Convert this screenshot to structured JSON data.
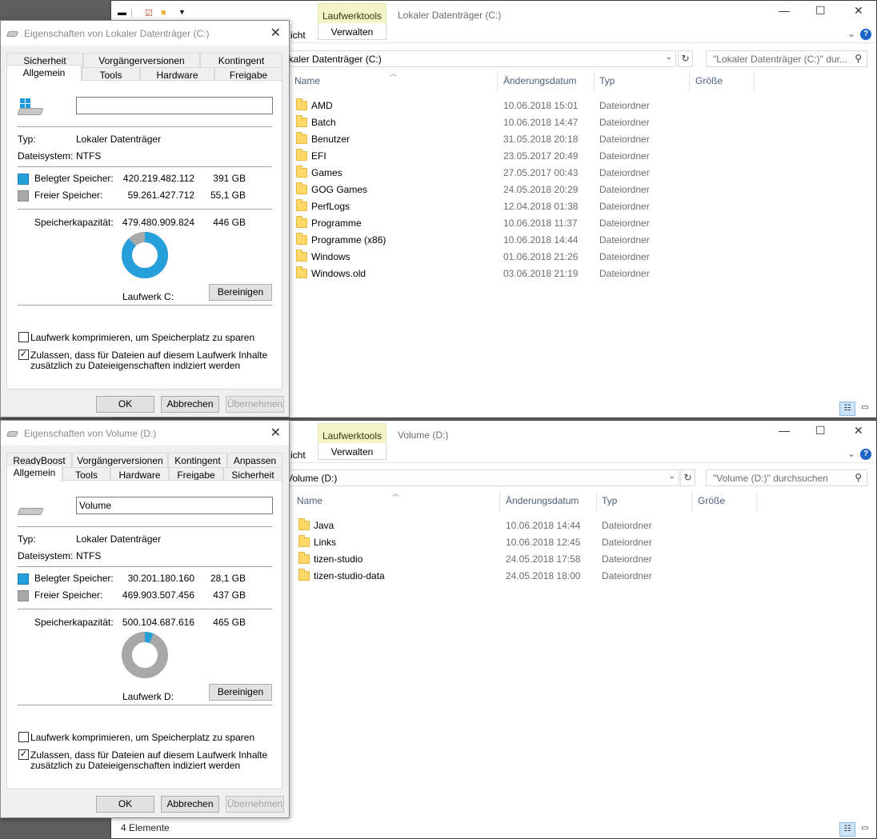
{
  "explorer_c": {
    "ribbon_ctx_tab": "Laufwerktools",
    "title": "Lokaler Datenträger (C:)",
    "ribbon_left_partial": "icht",
    "ribbon_manage": "Verwalten",
    "address_partial": "okaler Datenträger (C:)",
    "search_placeholder": "\"Lokaler Datenträger (C:)\" dur...",
    "col_name": "Name",
    "col_date": "Änderungsdatum",
    "col_type": "Typ",
    "col_size": "Größe",
    "rows": [
      {
        "name": "AMD",
        "date": "10.06.2018 15:01",
        "type": "Dateiordner"
      },
      {
        "name": "Batch",
        "date": "10.06.2018 14:47",
        "type": "Dateiordner"
      },
      {
        "name": "Benutzer",
        "date": "31.05.2018 20:18",
        "type": "Dateiordner"
      },
      {
        "name": "EFI",
        "date": "23.05.2017 20:49",
        "type": "Dateiordner"
      },
      {
        "name": "Games",
        "date": "27.05.2017 00:43",
        "type": "Dateiordner"
      },
      {
        "name": "GOG Games",
        "date": "24.05.2018 20:29",
        "type": "Dateiordner"
      },
      {
        "name": "PerfLogs",
        "date": "12.04.2018 01:38",
        "type": "Dateiordner"
      },
      {
        "name": "Programme",
        "date": "10.06.2018 11:37",
        "type": "Dateiordner"
      },
      {
        "name": "Programme (x86)",
        "date": "10.06.2018 14:44",
        "type": "Dateiordner"
      },
      {
        "name": "Windows",
        "date": "01.06.2018 21:26",
        "type": "Dateiordner"
      },
      {
        "name": "Windows.old",
        "date": "03.06.2018 21:19",
        "type": "Dateiordner"
      }
    ]
  },
  "explorer_d": {
    "ribbon_ctx_tab": "Laufwerktools",
    "title": "Volume (D:)",
    "ribbon_left_partial": "icht",
    "ribbon_manage": "Verwalten",
    "address_partial": "Volume (D:)",
    "search_placeholder": "\"Volume (D:)\" durchsuchen",
    "col_name": "Name",
    "col_date": "Änderungsdatum",
    "col_type": "Typ",
    "col_size": "Größe",
    "rows": [
      {
        "name": "Java",
        "date": "10.06.2018 14:44",
        "type": "Dateiordner"
      },
      {
        "name": "Links",
        "date": "10.06.2018 12:45",
        "type": "Dateiordner"
      },
      {
        "name": "tizen-studio",
        "date": "24.05.2018 17:58",
        "type": "Dateiordner"
      },
      {
        "name": "tizen-studio-data",
        "date": "24.05.2018 18:00",
        "type": "Dateiordner"
      }
    ],
    "status": "4 Elemente"
  },
  "dialog_c": {
    "title": "Eigenschaften von Lokaler Datenträger (C:)",
    "tabs_row1": [
      "Sicherheit",
      "Vorgängerversionen",
      "Kontingent"
    ],
    "tabs_row2": [
      "Allgemein",
      "Tools",
      "Hardware",
      "Freigabe"
    ],
    "name_value": "",
    "type_label": "Typ:",
    "type_value": "Lokaler Datenträger",
    "fs_label": "Dateisystem:",
    "fs_value": "NTFS",
    "used_label": "Belegter Speicher:",
    "used_bytes": "420.219.482.112",
    "used_gb": "391 GB",
    "free_label": "Freier Speicher:",
    "free_bytes": "59.261.427.712",
    "free_gb": "55,1 GB",
    "cap_label": "Speicherkapazität:",
    "cap_bytes": "479.480.909.824",
    "cap_gb": "446 GB",
    "used_fraction": 0.876,
    "drive_label": "Laufwerk C:",
    "cleanup": "Bereinigen",
    "compress": "Laufwerk komprimieren, um Speicherplatz zu sparen",
    "index_line1": "Zulassen, dass für Dateien auf diesem Laufwerk Inhalte",
    "index_line2": "zusätzlich zu Dateieigenschaften indiziert werden",
    "compress_checked": false,
    "index_checked": true,
    "ok": "OK",
    "cancel": "Abbrechen",
    "apply": "Übernehmen"
  },
  "dialog_d": {
    "title": "Eigenschaften von Volume (D:)",
    "tabs_row1": [
      "ReadyBoost",
      "Vorgängerversionen",
      "Kontingent",
      "Anpassen"
    ],
    "tabs_row2": [
      "Allgemein",
      "Tools",
      "Hardware",
      "Freigabe",
      "Sicherheit"
    ],
    "name_value": "Volume",
    "type_label": "Typ:",
    "type_value": "Lokaler Datenträger",
    "fs_label": "Dateisystem:",
    "fs_value": "NTFS",
    "used_label": "Belegter Speicher:",
    "used_bytes": "30.201.180.160",
    "used_gb": "28,1 GB",
    "free_label": "Freier Speicher:",
    "free_bytes": "469.903.507.456",
    "free_gb": "437 GB",
    "cap_label": "Speicherkapazität:",
    "cap_bytes": "500.104.687.616",
    "cap_gb": "465 GB",
    "used_fraction": 0.06,
    "drive_label": "Laufwerk D:",
    "cleanup": "Bereinigen",
    "compress": "Laufwerk komprimieren, um Speicherplatz zu sparen",
    "index_line1": "Zulassen, dass für Dateien auf diesem Laufwerk Inhalte",
    "index_line2": "zusätzlich zu Dateieigenschaften indiziert werden",
    "compress_checked": false,
    "index_checked": true,
    "ok": "OK",
    "cancel": "Abbrechen",
    "apply": "Übernehmen"
  },
  "colors": {
    "used": "#26a0da",
    "free": "#a8a8a8",
    "ctx_tab_bg": "#f3f5c6",
    "header_text": "#4c607a"
  }
}
